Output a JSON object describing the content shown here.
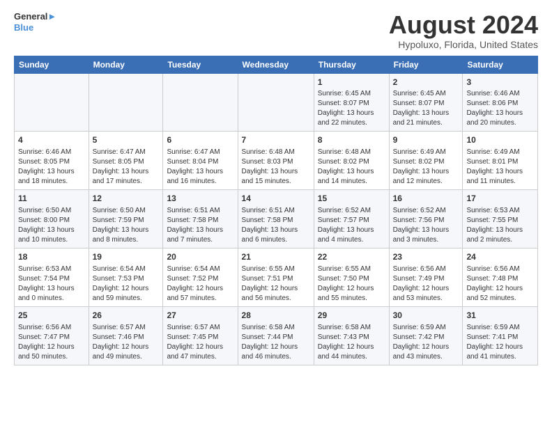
{
  "header": {
    "logo_line1": "General",
    "logo_line2": "Blue",
    "title": "August 2024",
    "subtitle": "Hypoluxo, Florida, United States"
  },
  "weekdays": [
    "Sunday",
    "Monday",
    "Tuesday",
    "Wednesday",
    "Thursday",
    "Friday",
    "Saturday"
  ],
  "rows": [
    [
      {
        "day": "",
        "content": ""
      },
      {
        "day": "",
        "content": ""
      },
      {
        "day": "",
        "content": ""
      },
      {
        "day": "",
        "content": ""
      },
      {
        "day": "1",
        "content": "Sunrise: 6:45 AM\nSunset: 8:07 PM\nDaylight: 13 hours and 22 minutes."
      },
      {
        "day": "2",
        "content": "Sunrise: 6:45 AM\nSunset: 8:07 PM\nDaylight: 13 hours and 21 minutes."
      },
      {
        "day": "3",
        "content": "Sunrise: 6:46 AM\nSunset: 8:06 PM\nDaylight: 13 hours and 20 minutes."
      }
    ],
    [
      {
        "day": "4",
        "content": "Sunrise: 6:46 AM\nSunset: 8:05 PM\nDaylight: 13 hours and 18 minutes."
      },
      {
        "day": "5",
        "content": "Sunrise: 6:47 AM\nSunset: 8:05 PM\nDaylight: 13 hours and 17 minutes."
      },
      {
        "day": "6",
        "content": "Sunrise: 6:47 AM\nSunset: 8:04 PM\nDaylight: 13 hours and 16 minutes."
      },
      {
        "day": "7",
        "content": "Sunrise: 6:48 AM\nSunset: 8:03 PM\nDaylight: 13 hours and 15 minutes."
      },
      {
        "day": "8",
        "content": "Sunrise: 6:48 AM\nSunset: 8:02 PM\nDaylight: 13 hours and 14 minutes."
      },
      {
        "day": "9",
        "content": "Sunrise: 6:49 AM\nSunset: 8:02 PM\nDaylight: 13 hours and 12 minutes."
      },
      {
        "day": "10",
        "content": "Sunrise: 6:49 AM\nSunset: 8:01 PM\nDaylight: 13 hours and 11 minutes."
      }
    ],
    [
      {
        "day": "11",
        "content": "Sunrise: 6:50 AM\nSunset: 8:00 PM\nDaylight: 13 hours and 10 minutes."
      },
      {
        "day": "12",
        "content": "Sunrise: 6:50 AM\nSunset: 7:59 PM\nDaylight: 13 hours and 8 minutes."
      },
      {
        "day": "13",
        "content": "Sunrise: 6:51 AM\nSunset: 7:58 PM\nDaylight: 13 hours and 7 minutes."
      },
      {
        "day": "14",
        "content": "Sunrise: 6:51 AM\nSunset: 7:58 PM\nDaylight: 13 hours and 6 minutes."
      },
      {
        "day": "15",
        "content": "Sunrise: 6:52 AM\nSunset: 7:57 PM\nDaylight: 13 hours and 4 minutes."
      },
      {
        "day": "16",
        "content": "Sunrise: 6:52 AM\nSunset: 7:56 PM\nDaylight: 13 hours and 3 minutes."
      },
      {
        "day": "17",
        "content": "Sunrise: 6:53 AM\nSunset: 7:55 PM\nDaylight: 13 hours and 2 minutes."
      }
    ],
    [
      {
        "day": "18",
        "content": "Sunrise: 6:53 AM\nSunset: 7:54 PM\nDaylight: 13 hours and 0 minutes."
      },
      {
        "day": "19",
        "content": "Sunrise: 6:54 AM\nSunset: 7:53 PM\nDaylight: 12 hours and 59 minutes."
      },
      {
        "day": "20",
        "content": "Sunrise: 6:54 AM\nSunset: 7:52 PM\nDaylight: 12 hours and 57 minutes."
      },
      {
        "day": "21",
        "content": "Sunrise: 6:55 AM\nSunset: 7:51 PM\nDaylight: 12 hours and 56 minutes."
      },
      {
        "day": "22",
        "content": "Sunrise: 6:55 AM\nSunset: 7:50 PM\nDaylight: 12 hours and 55 minutes."
      },
      {
        "day": "23",
        "content": "Sunrise: 6:56 AM\nSunset: 7:49 PM\nDaylight: 12 hours and 53 minutes."
      },
      {
        "day": "24",
        "content": "Sunrise: 6:56 AM\nSunset: 7:48 PM\nDaylight: 12 hours and 52 minutes."
      }
    ],
    [
      {
        "day": "25",
        "content": "Sunrise: 6:56 AM\nSunset: 7:47 PM\nDaylight: 12 hours and 50 minutes."
      },
      {
        "day": "26",
        "content": "Sunrise: 6:57 AM\nSunset: 7:46 PM\nDaylight: 12 hours and 49 minutes."
      },
      {
        "day": "27",
        "content": "Sunrise: 6:57 AM\nSunset: 7:45 PM\nDaylight: 12 hours and 47 minutes."
      },
      {
        "day": "28",
        "content": "Sunrise: 6:58 AM\nSunset: 7:44 PM\nDaylight: 12 hours and 46 minutes."
      },
      {
        "day": "29",
        "content": "Sunrise: 6:58 AM\nSunset: 7:43 PM\nDaylight: 12 hours and 44 minutes."
      },
      {
        "day": "30",
        "content": "Sunrise: 6:59 AM\nSunset: 7:42 PM\nDaylight: 12 hours and 43 minutes."
      },
      {
        "day": "31",
        "content": "Sunrise: 6:59 AM\nSunset: 7:41 PM\nDaylight: 12 hours and 41 minutes."
      }
    ]
  ]
}
